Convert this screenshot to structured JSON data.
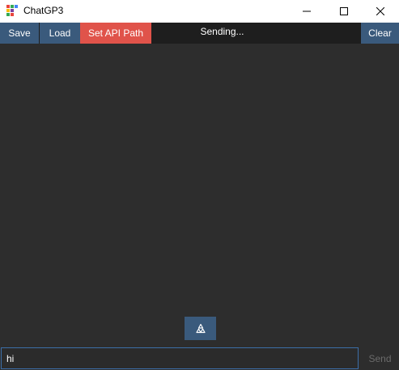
{
  "window": {
    "title": "ChatGP3"
  },
  "toolbar": {
    "save_label": "Save",
    "load_label": "Load",
    "set_api_label": "Set API Path",
    "status": "Sending...",
    "clear_label": "Clear"
  },
  "input": {
    "value": "hi",
    "send_label": "Send"
  },
  "icons": {
    "regenerate": "recycle-icon",
    "app": "app-logo-icon"
  },
  "colors": {
    "button_blue": "#3a5a7c",
    "button_red": "#e0534a",
    "background": "#2d2d2d",
    "input_border": "#3c6ea8"
  }
}
